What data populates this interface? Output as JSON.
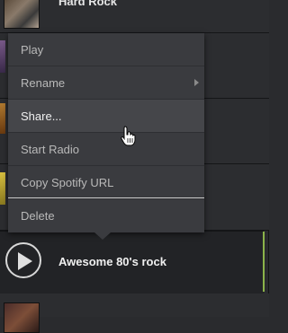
{
  "playlists": {
    "top_title": "Hard Rock",
    "selected_title": "Awesome 80's rock"
  },
  "context_menu": {
    "items": [
      {
        "label": "Play"
      },
      {
        "label": "Rename"
      },
      {
        "label": "Share..."
      },
      {
        "label": "Start Radio"
      },
      {
        "label": "Copy Spotify URL"
      },
      {
        "label": "Delete"
      }
    ]
  },
  "colors": {
    "accent": "#8bb34a",
    "menu_bg": "#3a3b3f",
    "background": "#2a2b2e"
  }
}
